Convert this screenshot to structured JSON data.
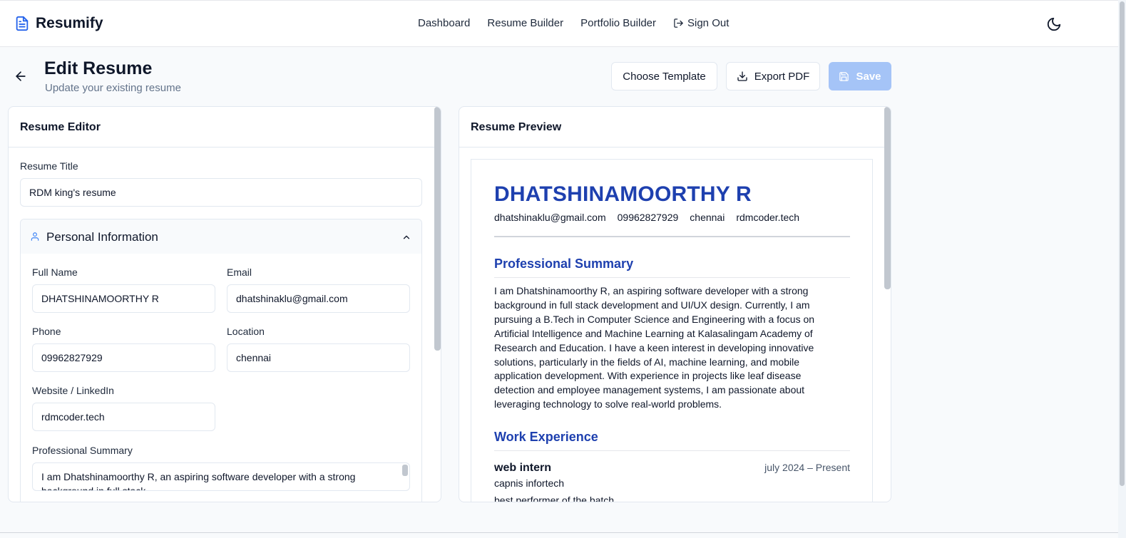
{
  "brand": {
    "name": "Resumify",
    "logo_icon": "file-text-icon"
  },
  "nav": {
    "items": [
      "Dashboard",
      "Resume Builder",
      "Portfolio Builder"
    ],
    "sign_out": "Sign Out",
    "sign_out_icon": "log-out-icon",
    "theme_icon": "moon-icon"
  },
  "header": {
    "title": "Edit Resume",
    "subtitle": "Update your existing resume",
    "back_icon": "arrow-left-icon"
  },
  "actions": {
    "choose_template": "Choose Template",
    "export_pdf": "Export PDF",
    "save": "Save"
  },
  "editor": {
    "panel_title": "Resume Editor",
    "resume_title_label": "Resume Title",
    "resume_title_value": "RDM king's resume",
    "personal": {
      "section_title": "Personal Information",
      "full_name_label": "Full Name",
      "full_name_value": "DHATSHINAMOORTHY R",
      "email_label": "Email",
      "email_value": "dhatshinaklu@gmail.com",
      "phone_label": "Phone",
      "phone_value": "09962827929",
      "location_label": "Location",
      "location_value": "chennai",
      "website_label": "Website / LinkedIn",
      "website_value": "rdmcoder.tech",
      "summary_label": "Professional Summary",
      "summary_value": "I am Dhatshinamoorthy R, an aspiring software developer with a strong background in full stack"
    }
  },
  "preview": {
    "panel_title": "Resume Preview",
    "name": "DHATSHINAMOORTHY R",
    "contacts": [
      "dhatshinaklu@gmail.com",
      "09962827929",
      "chennai",
      "rdmcoder.tech"
    ],
    "summary_heading": "Professional Summary",
    "summary_text": "I am Dhatshinamoorthy R, an aspiring software developer with a strong background in full stack development and UI/UX design. Currently, I am pursuing a B.Tech in Computer Science and Engineering with a focus on Artificial Intelligence and Machine Learning at Kalasalingam Academy of Research and Education. I have a keen interest in developing innovative solutions, particularly in the fields of AI, machine learning, and mobile application development. With experience in projects like leaf disease detection and employee management systems, I am passionate about leveraging technology to solve real-world problems.",
    "experience_heading": "Work Experience",
    "job_title": "web intern",
    "job_dates": "july 2024 – Present",
    "company": "capnis infortech",
    "job_desc": "best performer of the batch"
  },
  "colors": {
    "accent": "#1e40af",
    "save_disabled": "#a5c4f7",
    "border": "#e2e8f0"
  }
}
